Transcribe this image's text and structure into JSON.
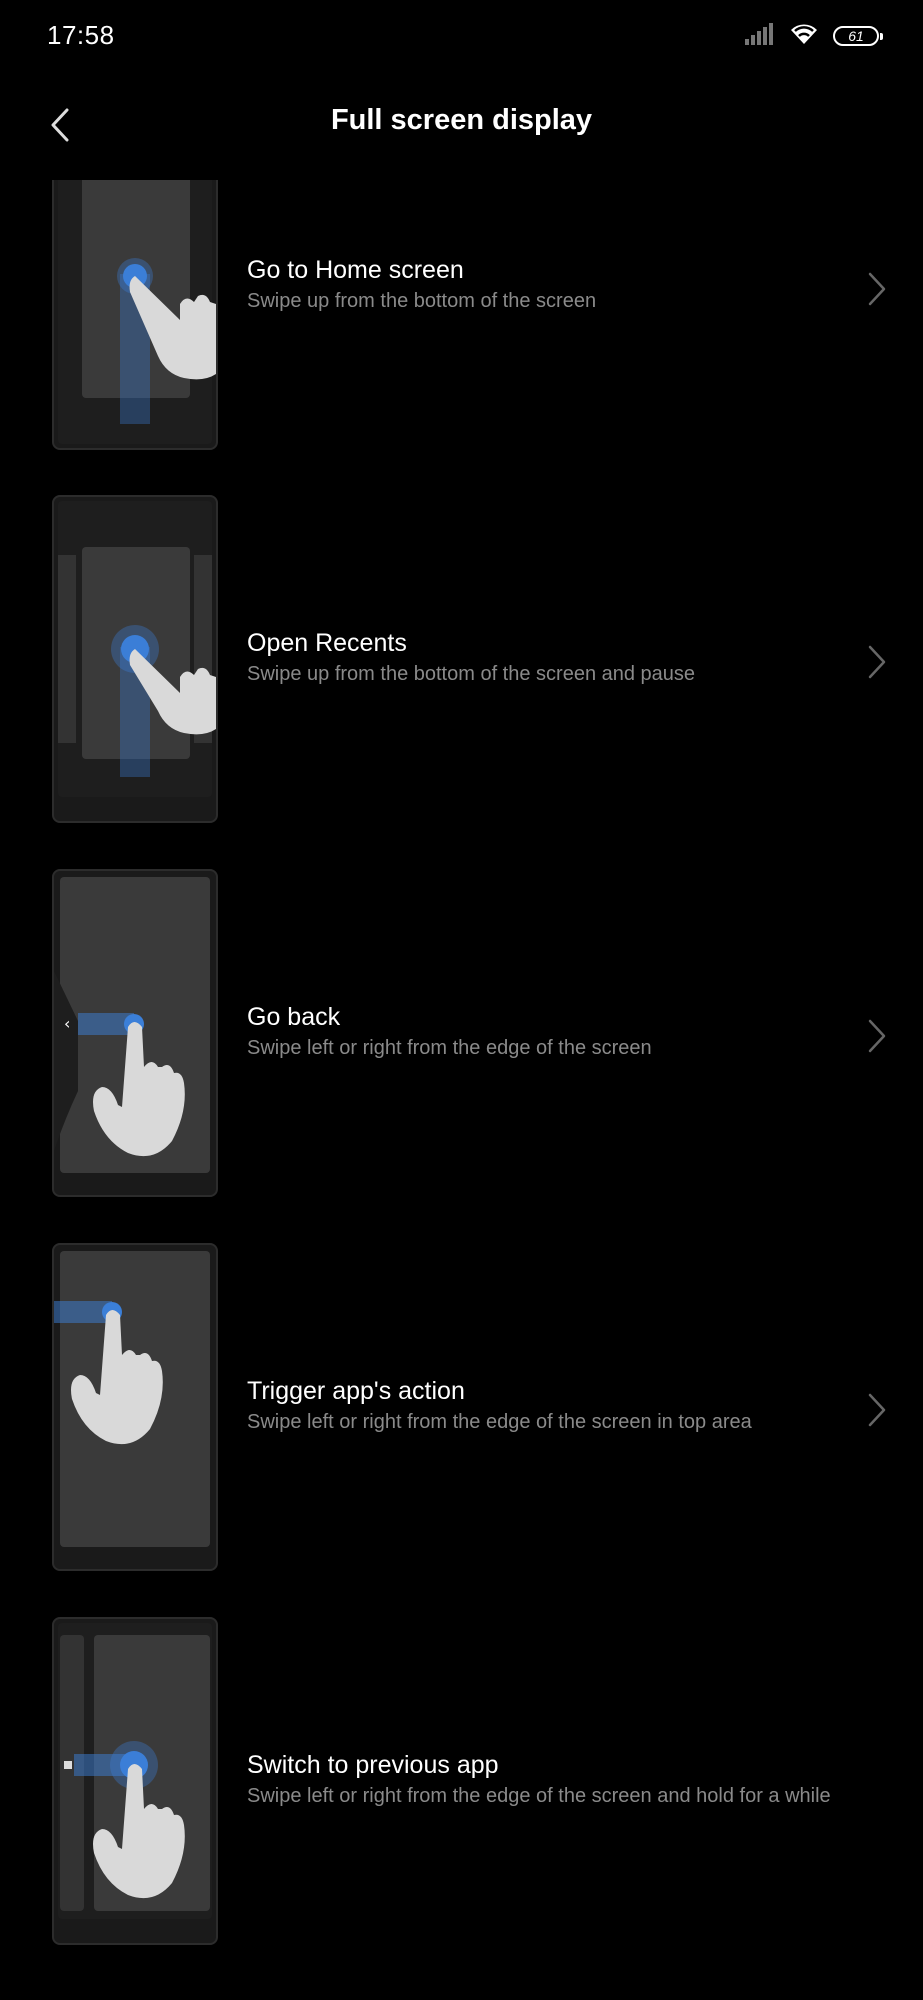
{
  "status_bar": {
    "time": "17:58",
    "battery_level": "61",
    "icons": [
      "signal-icon",
      "wifi-icon",
      "battery-icon"
    ]
  },
  "header": {
    "title": "Full screen display",
    "back_icon": "chevron-left-icon"
  },
  "items": [
    {
      "title": "Go to Home screen",
      "subtitle": "Swipe up from the bottom of the screen",
      "illustration": "gesture-home-icon"
    },
    {
      "title": "Open Recents",
      "subtitle": "Swipe up from the bottom of the screen and pause",
      "illustration": "gesture-recents-icon"
    },
    {
      "title": "Go back",
      "subtitle": "Swipe left or right from the edge of the screen",
      "illustration": "gesture-back-icon"
    },
    {
      "title": "Trigger app's action",
      "subtitle": "Swipe left or right from the edge of the screen in top area",
      "illustration": "gesture-trigger-icon"
    },
    {
      "title": "Switch to previous app",
      "subtitle": "Swipe left or right from the edge of the screen and hold for a while",
      "illustration": "gesture-switch-app-icon"
    }
  ],
  "colors": {
    "background": "#000000",
    "accent_blue": "#3b7fd8",
    "subtitle_gray": "#8a8a8a",
    "hand": "#d9d9d9"
  }
}
